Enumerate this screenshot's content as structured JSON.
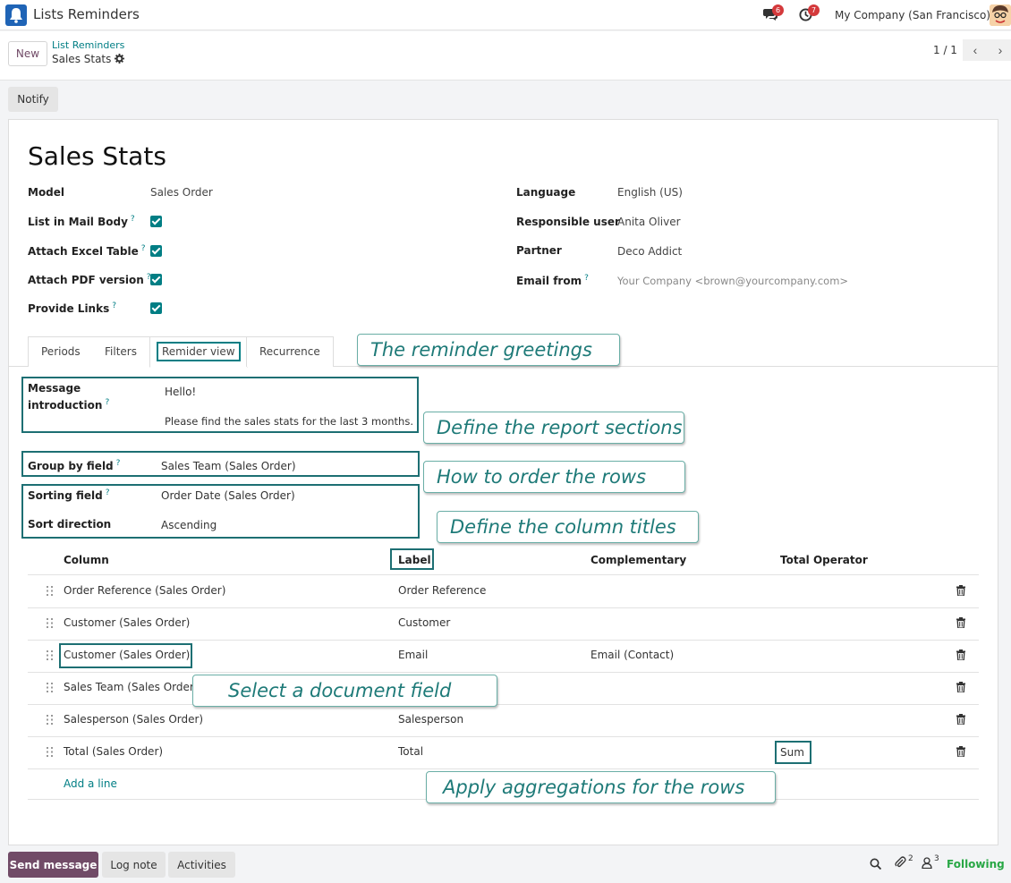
{
  "app": {
    "title": "Lists Reminders"
  },
  "nav": {
    "messages_count": "6",
    "activities_count": "7",
    "company": "My Company (San Francisco)"
  },
  "control": {
    "new_label": "New",
    "breadcrumb_parent": "List Reminders",
    "breadcrumb_current": "Sales Stats",
    "pager": "1 / 1"
  },
  "status": {
    "notify_label": "Notify"
  },
  "record": {
    "title": "Sales Stats",
    "fields_left": [
      {
        "label": "Model",
        "value": "Sales Order"
      },
      {
        "label": "List in Mail Body",
        "help": "?",
        "checked": true
      },
      {
        "label": "Attach Excel Table",
        "help": "?",
        "checked": true
      },
      {
        "label": "Attach PDF version",
        "help": "?",
        "checked": true
      },
      {
        "label": "Provide Links",
        "help": "?",
        "checked": true
      }
    ],
    "fields_right": [
      {
        "label": "Language",
        "value": "English (US)"
      },
      {
        "label": "Responsible user",
        "value": "Anita Oliver"
      },
      {
        "label": "Partner",
        "value": "Deco Addict"
      },
      {
        "label": "Email from",
        "help": "?",
        "value": "Your Company <brown@yourcompany.com>"
      }
    ]
  },
  "tabs": [
    "Periods",
    "Filters",
    "Remider view",
    "Recurrence"
  ],
  "reminder_view": {
    "message_label_1": "Message",
    "message_label_2": "introduction",
    "message_help": "?",
    "message_line1": "Hello!",
    "message_line2": "Please find the sales stats for the last 3 months.",
    "group_label": "Group by field",
    "group_help": "?",
    "group_value": "Sales Team (Sales Order)",
    "sort_field_label": "Sorting field",
    "sort_field_help": "?",
    "sort_field_value": "Order Date (Sales Order)",
    "sort_dir_label": "Sort direction",
    "sort_dir_value": "Ascending"
  },
  "table": {
    "headers": [
      "Column",
      "Label",
      "Complementary",
      "Total Operator"
    ],
    "rows": [
      {
        "column": "Order Reference (Sales Order)",
        "label": "Order Reference",
        "complementary": "",
        "total": ""
      },
      {
        "column": "Customer (Sales Order)",
        "label": "Customer",
        "complementary": "",
        "total": ""
      },
      {
        "column": "Customer (Sales Order)",
        "label": "Email",
        "complementary": "Email (Contact)",
        "total": ""
      },
      {
        "column": "Sales Team (Sales Order)",
        "label": "",
        "complementary": "",
        "total": ""
      },
      {
        "column": "Salesperson (Sales Order)",
        "label": "Salesperson",
        "complementary": "",
        "total": ""
      },
      {
        "column": "Total (Sales Order)",
        "label": "Total",
        "complementary": "",
        "total": "Sum"
      }
    ],
    "add_line": "Add a line"
  },
  "callouts": {
    "greetings": "The reminder greetings",
    "sections": "Define the report sections",
    "order": "How to order the rows",
    "titles": "Define the column titles",
    "field": "Select a document field",
    "aggregations": "Apply aggregations for the rows"
  },
  "chatter": {
    "send_label": "Send message",
    "log_label": "Log note",
    "activities_label": "Activities",
    "attachments_count": "2",
    "followers_count": "3",
    "following_label": "Following"
  },
  "colors": {
    "accent": "#017e84",
    "primary": "#714b67",
    "callout_text": "#1e7a78"
  }
}
